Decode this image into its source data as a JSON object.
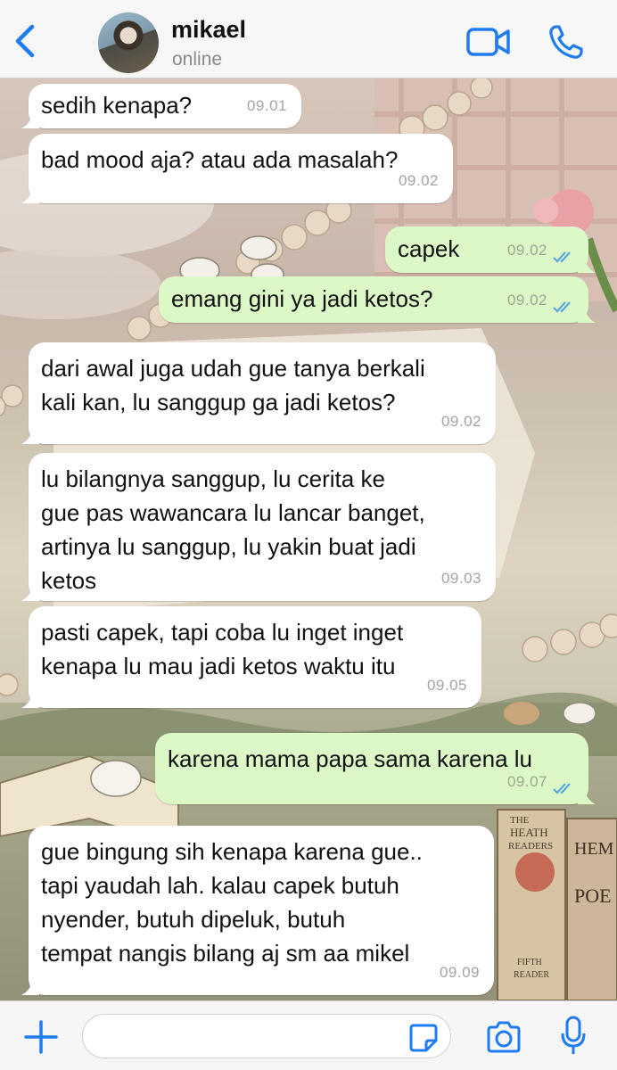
{
  "header": {
    "contact_name": "mikael",
    "status": "online",
    "accent_color": "#1f7cf0"
  },
  "messages": [
    {
      "direction": "in",
      "text": "sedih kenapa?",
      "time": "09.01"
    },
    {
      "direction": "in",
      "text": "bad mood aja? atau ada masalah?",
      "time": "09.02"
    },
    {
      "direction": "out",
      "text": "capek",
      "time": "09.02",
      "status": "read"
    },
    {
      "direction": "out",
      "text": "emang gini ya jadi ketos?",
      "time": "09.02",
      "status": "read"
    },
    {
      "direction": "in",
      "lines": [
        "dari awal juga udah gue tanya berkali",
        "kali kan, lu sanggup ga jadi ketos?"
      ],
      "time": "09.02"
    },
    {
      "direction": "in",
      "lines": [
        "lu bilangnya sanggup, lu cerita ke",
        "gue pas wawancara lu lancar banget,",
        "artinya lu sanggup, lu yakin buat jadi",
        "ketos"
      ],
      "time": "09.03"
    },
    {
      "direction": "in",
      "lines": [
        "pasti capek, tapi coba lu inget inget",
        "kenapa lu mau jadi ketos waktu itu"
      ],
      "time": "09.05"
    },
    {
      "direction": "out",
      "text": "karena mama papa sama karena lu",
      "time": "09.07",
      "status": "read"
    },
    {
      "direction": "in",
      "lines": [
        "gue bingung sih kenapa karena gue..",
        "tapi yaudah lah. kalau capek butuh",
        "nyender, butuh dipeluk, butuh",
        "tempat nangis bilang aj sm aa mikel"
      ],
      "time": "09.09"
    }
  ],
  "wallpaper": {
    "book_labels": [
      "THE",
      "HEATH",
      "READERS",
      "FIFTH",
      "READER",
      "HEM",
      "POE"
    ]
  },
  "composer": {
    "value": "",
    "placeholder": ""
  },
  "colors": {
    "incoming_bubble": "#ffffff",
    "outgoing_bubble": "#dcf8c6",
    "read_ticks": "#4fa3e0"
  }
}
